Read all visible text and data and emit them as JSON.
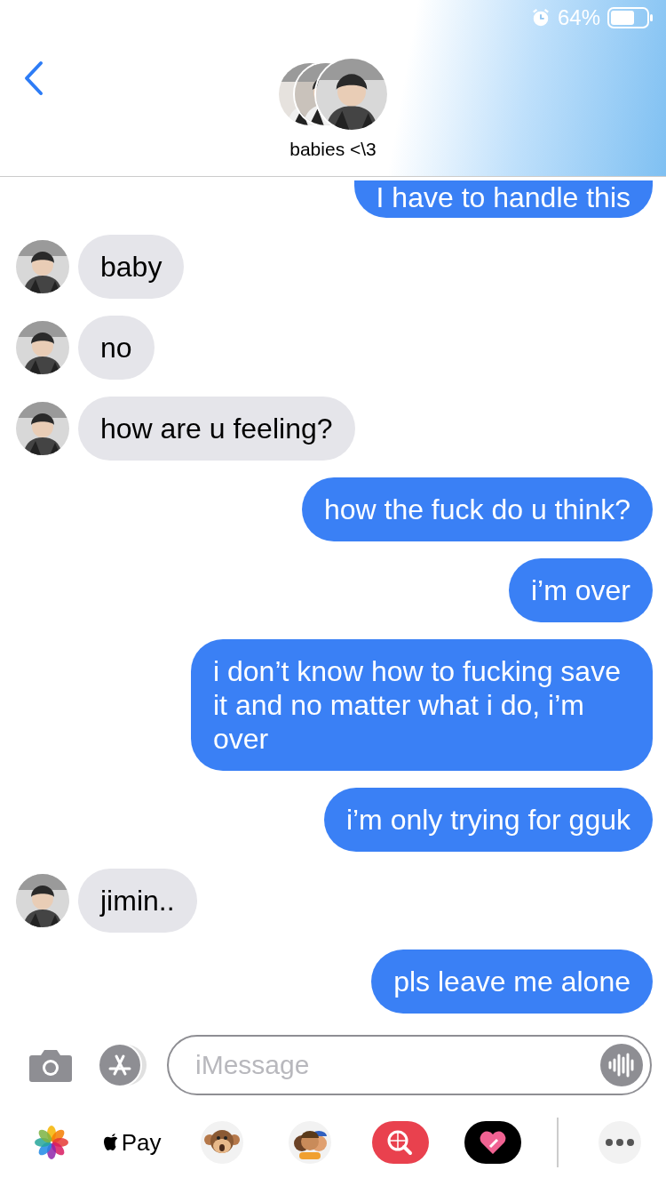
{
  "status_bar": {
    "battery": "64%"
  },
  "header": {
    "title": "babies <\\3"
  },
  "messages": [
    {
      "kind": "sent",
      "text": "I have to handle this"
    },
    {
      "kind": "received",
      "text": "baby"
    },
    {
      "kind": "received",
      "text": "no"
    },
    {
      "kind": "received",
      "text": "how are u feeling?"
    },
    {
      "kind": "sent",
      "text": "how the fuck do u think?"
    },
    {
      "kind": "sent",
      "text": "i’m over"
    },
    {
      "kind": "sent",
      "text": "i don’t know how to fucking save it and no matter what i do, i’m over"
    },
    {
      "kind": "sent",
      "text": "i’m only trying for gguk"
    },
    {
      "kind": "received",
      "text": "jimin.."
    },
    {
      "kind": "sent",
      "text": "pls leave me alone"
    }
  ],
  "composer": {
    "placeholder": "iMessage"
  },
  "app_drawer": {
    "apple_pay_label": "Pay"
  }
}
